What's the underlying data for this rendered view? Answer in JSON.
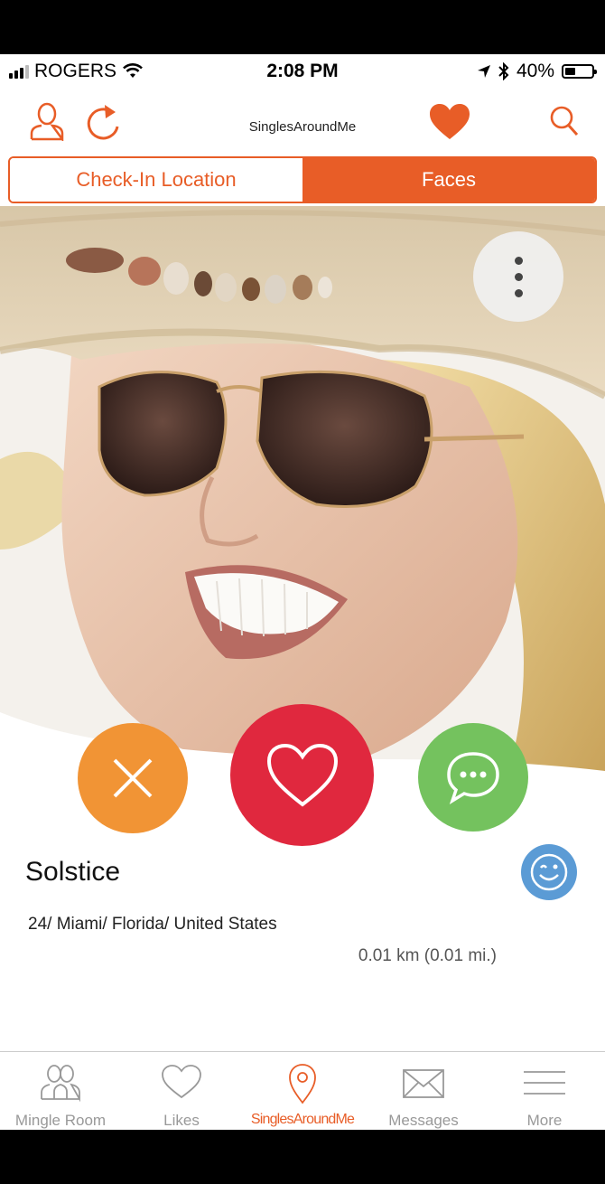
{
  "status_bar": {
    "carrier": "ROGERS",
    "time": "2:08 PM",
    "battery": "40%",
    "battery_level": 0.4
  },
  "header": {
    "title": "SinglesAroundMe",
    "icons": [
      "profile-icon",
      "refresh-icon",
      "heart-icon",
      "search-icon"
    ]
  },
  "segments": [
    {
      "label": "Check-In Location",
      "active": false
    },
    {
      "label": "Faces",
      "active": true
    }
  ],
  "profile": {
    "name": "Solstice",
    "details": "24/ Miami/ Florida/ United States",
    "distance": "0.01 km (0.01 mi.)"
  },
  "actions": [
    "close-icon",
    "heart-icon",
    "chat-icon",
    "wink-icon",
    "more-vertical-icon"
  ],
  "tab_bar": {
    "items": [
      {
        "label": "Mingle Room",
        "icon": "people-icon",
        "active": false
      },
      {
        "label": "Likes",
        "icon": "heart-outline-icon",
        "active": false
      },
      {
        "label": "SinglesAroundMe",
        "icon": "location-pin-icon",
        "active": true
      },
      {
        "label": "Messages",
        "icon": "envelope-icon",
        "active": false
      },
      {
        "label": "More",
        "icon": "menu-icon",
        "active": false
      }
    ]
  },
  "colors": {
    "accent": "#e85d27",
    "dislike": "#f19435",
    "like": "#e0283e",
    "chat": "#74c25e",
    "wink": "#5b9bd5"
  }
}
